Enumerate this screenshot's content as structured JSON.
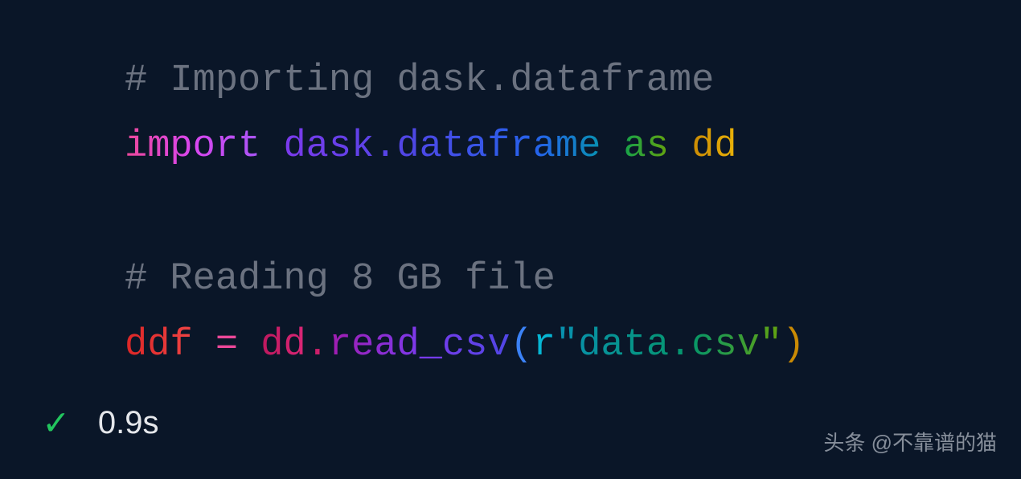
{
  "code": {
    "line1": {
      "comment": "# Importing dask.dataframe"
    },
    "line2": {
      "keyword_import": "import",
      "module": "dask.dataframe",
      "keyword_as": "as",
      "alias": "dd"
    },
    "line3": {
      "comment": "# Reading 8 GB file"
    },
    "line4": {
      "variable": "ddf",
      "equals": "=",
      "obj": "dd",
      "dot": ".",
      "method": "read_csv",
      "paren_open": "(",
      "prefix": "r",
      "string": "\"data.csv\"",
      "paren_close": ")"
    }
  },
  "status": {
    "checkmark": "✓",
    "timing": "0.9s"
  },
  "watermark": "头条 @不靠谱的猫"
}
